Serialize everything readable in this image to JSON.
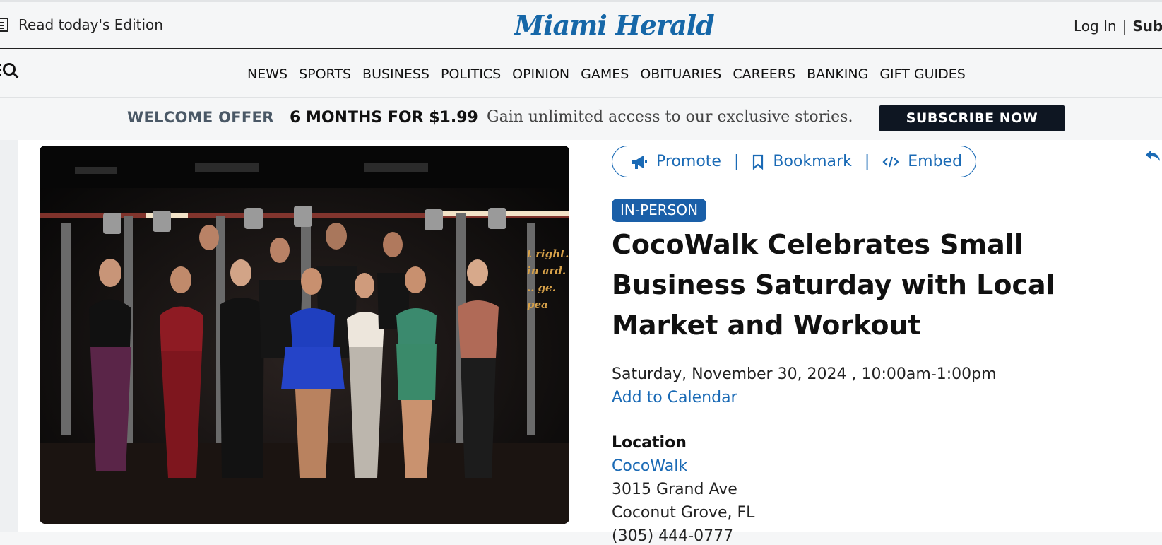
{
  "header": {
    "edition_label": "Read today's Edition",
    "logo": "Miami Herald",
    "login_label": "Log In",
    "separator": "|",
    "subscribe_label": "Subs"
  },
  "nav": {
    "items": [
      "NEWS",
      "SPORTS",
      "BUSINESS",
      "POLITICS",
      "OPINION",
      "GAMES",
      "OBITUARIES",
      "CAREERS",
      "BANKING",
      "GIFT GUIDES"
    ]
  },
  "offer": {
    "welcome": "WELCOME OFFER",
    "deal": "6 MONTHS FOR $1.99",
    "tagline": "Gain unlimited access to our exclusive stories.",
    "button": "SUBSCRIBE NOW"
  },
  "actions": {
    "promote": "Promote",
    "bookmark": "Bookmark",
    "embed": "Embed",
    "separator": "|"
  },
  "event": {
    "badge": "IN-PERSON",
    "title": "CocoWalk Celebrates Small Business Saturday with Local Market and Workout",
    "datetime": "Saturday, November 30, 2024 , 10:00am-1:00pm",
    "add_to_calendar": "Add to Calendar",
    "location_heading": "Location",
    "location_name": "CocoWalk",
    "address_line1": "3015 Grand Ave",
    "address_line2": "Coconut Grove, FL",
    "phone_partial": "(305) 444-0777"
  },
  "colors": {
    "link_blue": "#1a6ab5",
    "logo_blue": "#1667a8",
    "badge_blue": "#1a5fa8",
    "button_dark": "#0e1622"
  }
}
